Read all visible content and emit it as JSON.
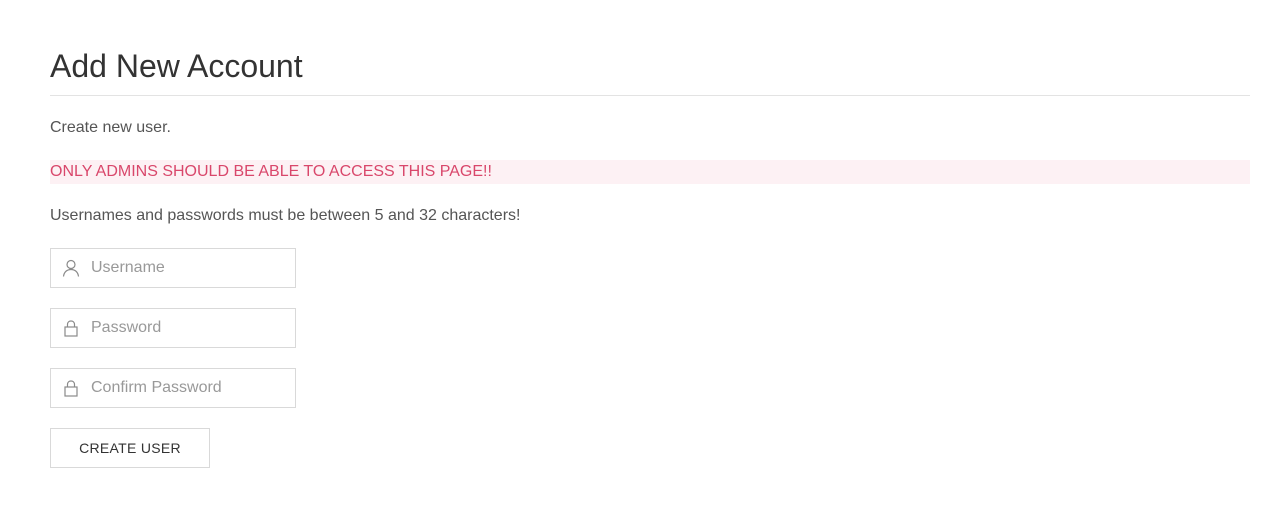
{
  "page": {
    "title": "Add New Account",
    "intro": "Create new user.",
    "warning": "ONLY ADMINS SHOULD BE ABLE TO ACCESS THIS PAGE!!",
    "rules": "Usernames and passwords must be between 5 and 32 characters!"
  },
  "form": {
    "username": {
      "placeholder": "Username",
      "value": "",
      "icon": "user-icon"
    },
    "password": {
      "placeholder": "Password",
      "value": "",
      "icon": "lock-icon"
    },
    "confirm_password": {
      "placeholder": "Confirm Password",
      "value": "",
      "icon": "lock-icon"
    },
    "submit_label": "CREATE USER"
  },
  "colors": {
    "warning_text": "#d9476b",
    "warning_background": "#fdf1f4",
    "border": "#d9d9d9",
    "title_text": "#333333",
    "body_text": "#555555",
    "placeholder_text": "#999999"
  }
}
